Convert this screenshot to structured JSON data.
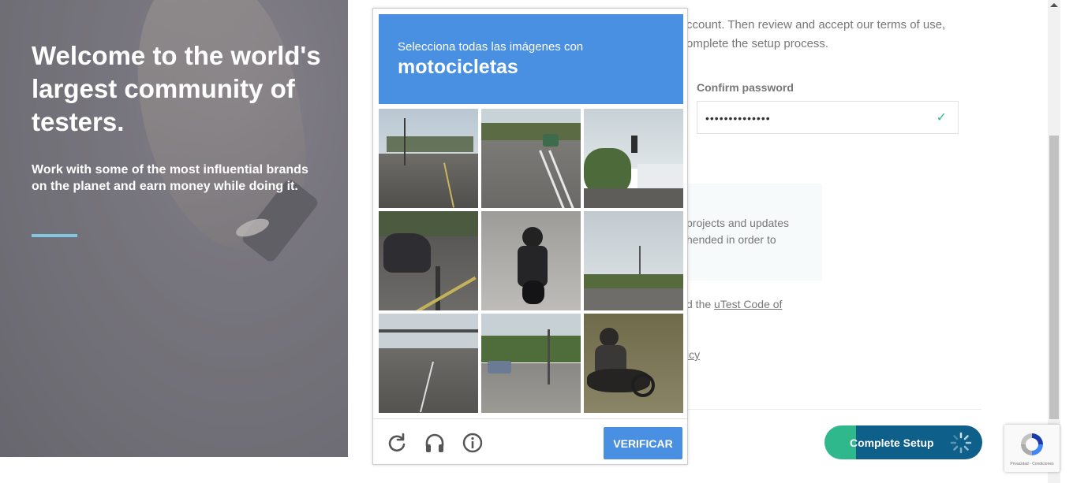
{
  "hero": {
    "title": "Welcome to the world's largest community of testers.",
    "subtitle": "Work with some of the most influential brands on the planet and earn money while doing it."
  },
  "form": {
    "intro_line1": "ccount. Then review and accept our terms of use,",
    "intro_line2": "omplete the setup process.",
    "confirm_password_label": "Confirm password",
    "confirm_password_value": "••••••••••••••",
    "info_line1": "projects and updates",
    "info_line2": "hended in order to",
    "code_prefix": "d the ",
    "code_link": "uTest Code of",
    "policy_link": "icy",
    "complete_button": "Complete Setup"
  },
  "captcha": {
    "instruction": "Selecciona todas las imágenes con",
    "target": "motocicletas",
    "verify_button": "VERIFICAR",
    "reload_icon": "reload-icon",
    "audio_icon": "headphones-icon",
    "info_icon": "info-icon",
    "tiles": [
      {
        "label": "tile-1"
      },
      {
        "label": "tile-2"
      },
      {
        "label": "tile-3"
      },
      {
        "label": "tile-4"
      },
      {
        "label": "tile-5"
      },
      {
        "label": "tile-6"
      },
      {
        "label": "tile-7"
      },
      {
        "label": "tile-8"
      },
      {
        "label": "tile-9"
      }
    ]
  },
  "recaptcha_badge": {
    "footer": "Privacidad - Condiciones"
  },
  "colors": {
    "captcha_blue": "#4a90e2",
    "complete_green": "#2fb88c",
    "complete_blue": "#0e5f8a",
    "accent_line": "#82c7df"
  }
}
